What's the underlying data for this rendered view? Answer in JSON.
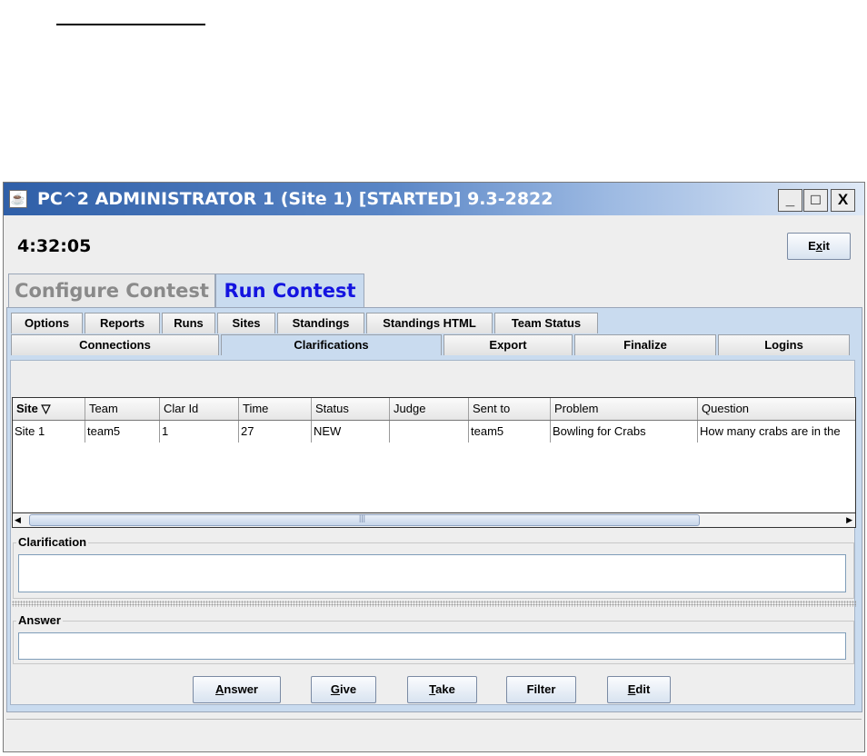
{
  "window": {
    "title": "PC^2 ADMINISTRATOR 1 (Site 1) [STARTED] 9.3-2822",
    "controls": [
      "_",
      "□",
      "X"
    ]
  },
  "clock": "4:32:05",
  "exit_button": {
    "pre": "E",
    "underlined": "x",
    "post": "it"
  },
  "main_tabs": [
    "Configure Contest",
    "Run Contest"
  ],
  "sub_tabs_row1": [
    "Options",
    "Reports",
    "Runs",
    "Sites",
    "Standings",
    "Standings HTML",
    "Team Status"
  ],
  "sub_tabs_row2": [
    "Connections",
    "Clarifications",
    "Export",
    "Finalize",
    "Logins"
  ],
  "table": {
    "columns": [
      "Site ▽",
      "Team",
      "Clar Id",
      "Time",
      "Status",
      "Judge",
      "Sent to",
      "Problem",
      "Question"
    ],
    "rows": [
      [
        "Site 1",
        "team5",
        "1",
        "27",
        "NEW",
        "",
        "team5",
        "Bowling for Crabs",
        "How many crabs are in the"
      ]
    ]
  },
  "scrollbar": {
    "left_arrow": "◀",
    "right_arrow": "▶",
    "grip": "|||"
  },
  "clarification_label": "Clarification",
  "answer_label": "Answer",
  "buttons": {
    "answer": {
      "u": "A",
      "rest": "nswer"
    },
    "give": {
      "u": "G",
      "rest": "ive"
    },
    "take": {
      "u": "T",
      "rest": "ake"
    },
    "filter": "Filter",
    "edit": {
      "u": "E",
      "rest": "dit"
    }
  }
}
